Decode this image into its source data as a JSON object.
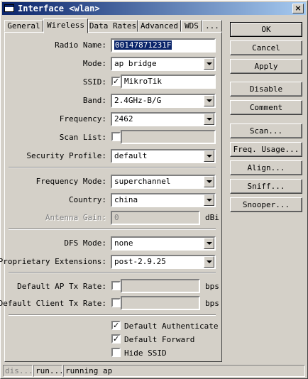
{
  "window": {
    "title": "Interface <wlan>",
    "close_glyph": "×"
  },
  "tabs": [
    "General",
    "Wireless",
    "Data Rates",
    "Advanced",
    "WDS",
    "..."
  ],
  "active_tab": "Wireless",
  "form": {
    "radio_name": {
      "label": "Radio Name:",
      "value": "00147871231F"
    },
    "mode": {
      "label": "Mode:",
      "value": "ap bridge"
    },
    "ssid": {
      "label": "SSID:",
      "value": "MikroTik",
      "checked": true
    },
    "band": {
      "label": "Band:",
      "value": "2.4GHz-B/G"
    },
    "frequency": {
      "label": "Frequency:",
      "value": "2462"
    },
    "scan_list": {
      "label": "Scan List:",
      "value": "",
      "checked": false
    },
    "security_profile": {
      "label": "Security Profile:",
      "value": "default"
    },
    "frequency_mode": {
      "label": "Frequency Mode:",
      "value": "superchannel"
    },
    "country": {
      "label": "Country:",
      "value": "china"
    },
    "antenna_gain": {
      "label": "Antenna Gain:",
      "value": "0",
      "unit": "dBi"
    },
    "dfs_mode": {
      "label": "DFS Mode:",
      "value": "none"
    },
    "proprietary_extensions": {
      "label": "Proprietary Extensions:",
      "value": "post-2.9.25"
    },
    "default_ap_tx_rate": {
      "label": "Default AP Tx Rate:",
      "value": "",
      "unit": "bps"
    },
    "default_client_tx_rate": {
      "label": "Default Client Tx Rate:",
      "value": "",
      "unit": "bps"
    },
    "default_authenticate": {
      "label": "Default Authenticate",
      "checked": true
    },
    "default_forward": {
      "label": "Default Forward",
      "checked": true
    },
    "hide_ssid": {
      "label": "Hide SSID",
      "checked": false
    }
  },
  "buttons": {
    "ok": "OK",
    "cancel": "Cancel",
    "apply": "Apply",
    "disable": "Disable",
    "comment": "Comment",
    "scan": "Scan...",
    "freq_usage": "Freq. Usage...",
    "align": "Align...",
    "sniff": "Sniff...",
    "snooper": "Snooper..."
  },
  "status_bar": [
    "dis...",
    "run...",
    "running ap"
  ],
  "check_glyph": "✓"
}
